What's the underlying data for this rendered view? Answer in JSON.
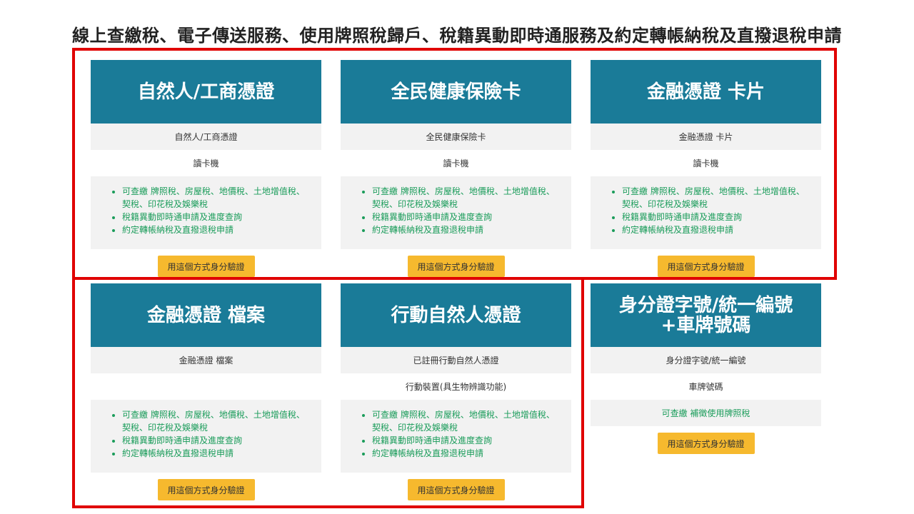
{
  "page": {
    "title": "線上查繳稅、電子傳送服務、使用牌照稅歸戶、稅籍異動即時通服務及約定轉帳納稅及直撥退稅申請"
  },
  "colors": {
    "header_bg": "#1a7b98",
    "button_bg": "#f6b92e",
    "feature_text": "#1a9c5a",
    "highlight_frame": "#e00000"
  },
  "cards": [
    {
      "title": "自然人/工商憑證",
      "cert": "自然人/工商憑證",
      "device": "讀卡機",
      "features": [
        "可查繳 牌照稅、房屋稅、地價稅、土地增值稅、契稅、印花稅及娛樂稅",
        "稅籍異動即時通申請及進度查詢",
        "約定轉帳納稅及直撥退稅申請"
      ],
      "button": "用這個方式身分驗證"
    },
    {
      "title": "全民健康保險卡",
      "cert": "全民健康保險卡",
      "device": "讀卡機",
      "features": [
        "可查繳 牌照稅、房屋稅、地價稅、土地增值稅、契稅、印花稅及娛樂稅",
        "稅籍異動即時通申請及進度查詢",
        "約定轉帳納稅及直撥退稅申請"
      ],
      "button": "用這個方式身分驗證"
    },
    {
      "title": "金融憑證 卡片",
      "cert": "金融憑證 卡片",
      "device": "讀卡機",
      "features": [
        "可查繳 牌照稅、房屋稅、地價稅、土地增值稅、契稅、印花稅及娛樂稅",
        "稅籍異動即時通申請及進度查詢",
        "約定轉帳納稅及直撥退稅申請"
      ],
      "button": "用這個方式身分驗證"
    },
    {
      "title": "金融憑證 檔案",
      "cert": "金融憑證 檔案",
      "device": "",
      "features": [
        "可查繳 牌照稅、房屋稅、地價稅、土地增值稅、契稅、印花稅及娛樂稅",
        "稅籍異動即時通申請及進度查詢",
        "約定轉帳納稅及直撥退稅申請"
      ],
      "button": "用這個方式身分驗證"
    },
    {
      "title": "行動自然人憑證",
      "cert": "已註冊行動自然人憑證",
      "device": "行動裝置(具生物辨識功能)",
      "features": [
        "可查繳 牌照稅、房屋稅、地價稅、土地增值稅、契稅、印花稅及娛樂稅",
        "稅籍異動即時通申請及進度查詢",
        "約定轉帳納稅及直撥退稅申請"
      ],
      "button": "用這個方式身分驗證"
    },
    {
      "title_line1": "身分證字號/統一編號",
      "title_line2": "+車牌號碼",
      "cert": "身分證字號/統一編號",
      "device": "車牌號碼",
      "feature": "可查繳 補徵使用牌照稅",
      "button": "用這個方式身分驗證"
    }
  ]
}
